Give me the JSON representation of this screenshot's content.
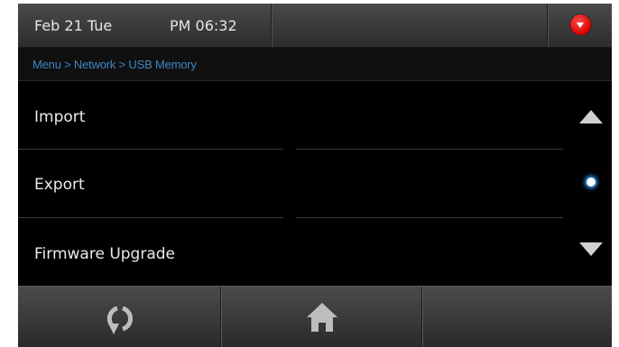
{
  "status_bar": {
    "date": "Feb 21 Tue",
    "time": "PM 06:32",
    "dropdown_icon": "dropdown-arrow-icon",
    "dropdown_color": "#e00000"
  },
  "breadcrumb": {
    "text": "Menu > Network > USB Memory",
    "color": "#3d86c6"
  },
  "menu": {
    "items": [
      {
        "label": "Import"
      },
      {
        "label": "Export"
      },
      {
        "label": "Firmware Upgrade"
      }
    ]
  },
  "scroll": {
    "up_icon": "triangle-up-icon",
    "down_icon": "triangle-down-icon",
    "indicator_icon": "scroll-position-dot"
  },
  "bottom_bar": {
    "back_icon": "refresh-back-icon",
    "home_icon": "home-icon"
  }
}
